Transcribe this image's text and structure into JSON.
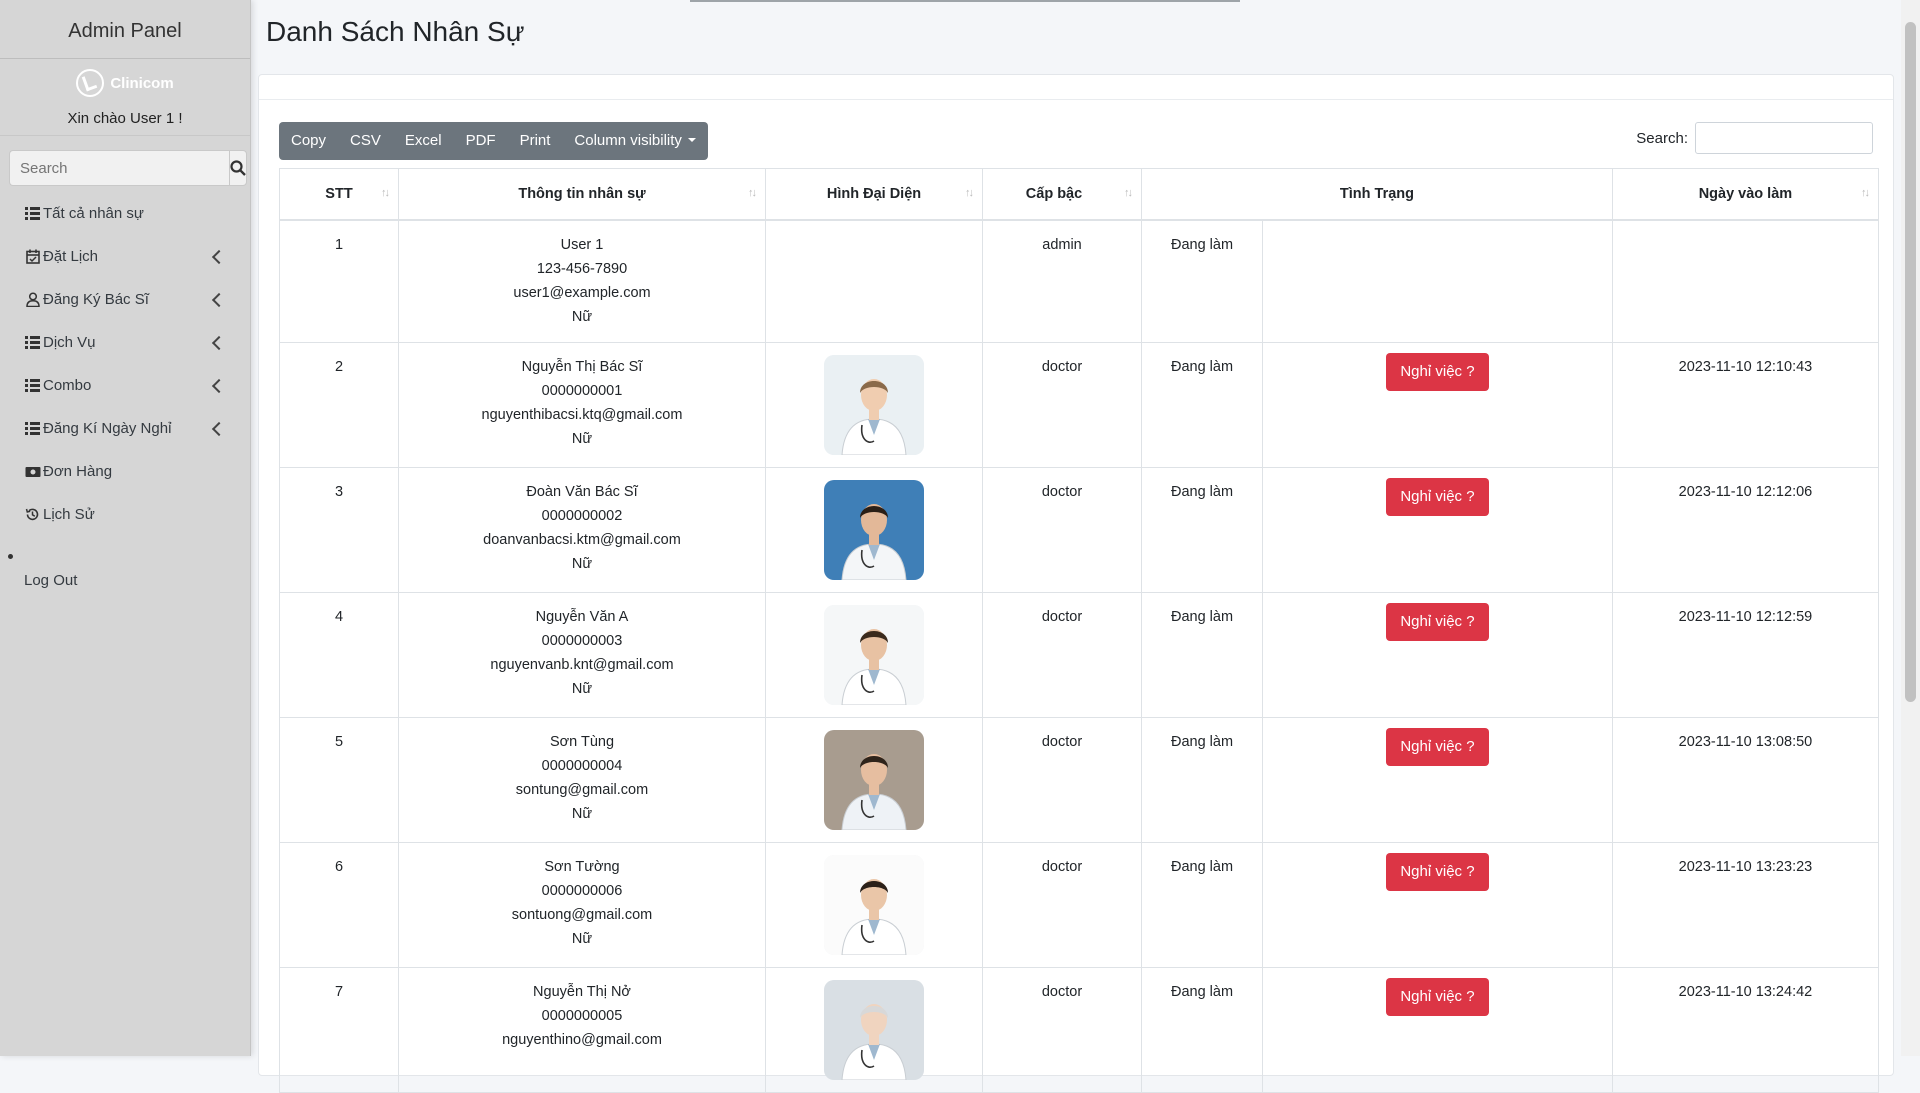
{
  "sidebar": {
    "brand": "Admin Panel",
    "logo_text": "Clinicom",
    "greeting": "Xin chào User 1 !",
    "search_placeholder": "Search",
    "items": [
      {
        "label": "Tất cả nhân sự",
        "icon": "list-icon",
        "has_submenu": false
      },
      {
        "label": "Đặt Lịch",
        "icon": "calendar-check-icon",
        "has_submenu": true
      },
      {
        "label": "Đăng Ký Bác Sĩ",
        "icon": "user-icon",
        "has_submenu": true
      },
      {
        "label": "Dịch Vụ",
        "icon": "list-icon",
        "has_submenu": true
      },
      {
        "label": "Combo",
        "icon": "list-icon",
        "has_submenu": true
      },
      {
        "label": "Đăng Kí Ngày Nghỉ",
        "icon": "list-icon",
        "has_submenu": true
      },
      {
        "label": "Đơn Hàng",
        "icon": "money-bill-icon",
        "has_submenu": false
      },
      {
        "label": "Lịch Sử",
        "icon": "history-icon",
        "has_submenu": false
      }
    ],
    "logout": "Log Out"
  },
  "main": {
    "title": "Danh Sách Nhân Sự",
    "toolbar": {
      "copy": "Copy",
      "csv": "CSV",
      "excel": "Excel",
      "pdf": "PDF",
      "print": "Print",
      "column_visibility": "Column visibility"
    },
    "search_label": "Search:",
    "table": {
      "headers": [
        "STT",
        "Thông tin nhân sự",
        "Hình Đại Diện",
        "Cấp bậc",
        "Tình Trạng",
        "Ngày vào làm"
      ],
      "quit_label": "Nghỉ việc ?",
      "rows": [
        {
          "stt": "1",
          "name": "User 1",
          "phone": "123-456-7890",
          "email": "user1@example.com",
          "gender": "Nữ",
          "rank": "admin",
          "status": "Đang làm",
          "date": "",
          "has_avatar": false
        },
        {
          "stt": "2",
          "name": "Nguyễn Thị Bác Sĩ",
          "phone": "0000000001",
          "email": "nguyenthibacsi.ktq@gmail.com",
          "gender": "Nữ",
          "rank": "doctor",
          "status": "Đang làm",
          "date": "2023-11-10 12:10:43",
          "has_avatar": true
        },
        {
          "stt": "3",
          "name": "Đoàn Văn Bác Sĩ",
          "phone": "0000000002",
          "email": "doanvanbacsi.ktm@gmail.com",
          "gender": "Nữ",
          "rank": "doctor",
          "status": "Đang làm",
          "date": "2023-11-10 12:12:06",
          "has_avatar": true
        },
        {
          "stt": "4",
          "name": "Nguyễn Văn A",
          "phone": "0000000003",
          "email": "nguyenvanb.knt@gmail.com",
          "gender": "Nữ",
          "rank": "doctor",
          "status": "Đang làm",
          "date": "2023-11-10 12:12:59",
          "has_avatar": true
        },
        {
          "stt": "5",
          "name": "Sơn Tùng",
          "phone": "0000000004",
          "email": "sontung@gmail.com",
          "gender": "Nữ",
          "rank": "doctor",
          "status": "Đang làm",
          "date": "2023-11-10 13:08:50",
          "has_avatar": true
        },
        {
          "stt": "6",
          "name": "Sơn Tường",
          "phone": "0000000006",
          "email": "sontuong@gmail.com",
          "gender": "Nữ",
          "rank": "doctor",
          "status": "Đang làm",
          "date": "2023-11-10 13:23:23",
          "has_avatar": true
        },
        {
          "stt": "7",
          "name": "Nguyễn Thị Nở",
          "phone": "0000000005",
          "email": "nguyenthino@gmail.com",
          "gender": "",
          "rank": "doctor",
          "status": "Đang làm",
          "date": "2023-11-10 13:24:42",
          "has_avatar": true
        }
      ]
    }
  },
  "colors": {
    "danger": "#dc3545",
    "toolbar": "#6c757d",
    "sidebar": "#d6d6d6"
  }
}
